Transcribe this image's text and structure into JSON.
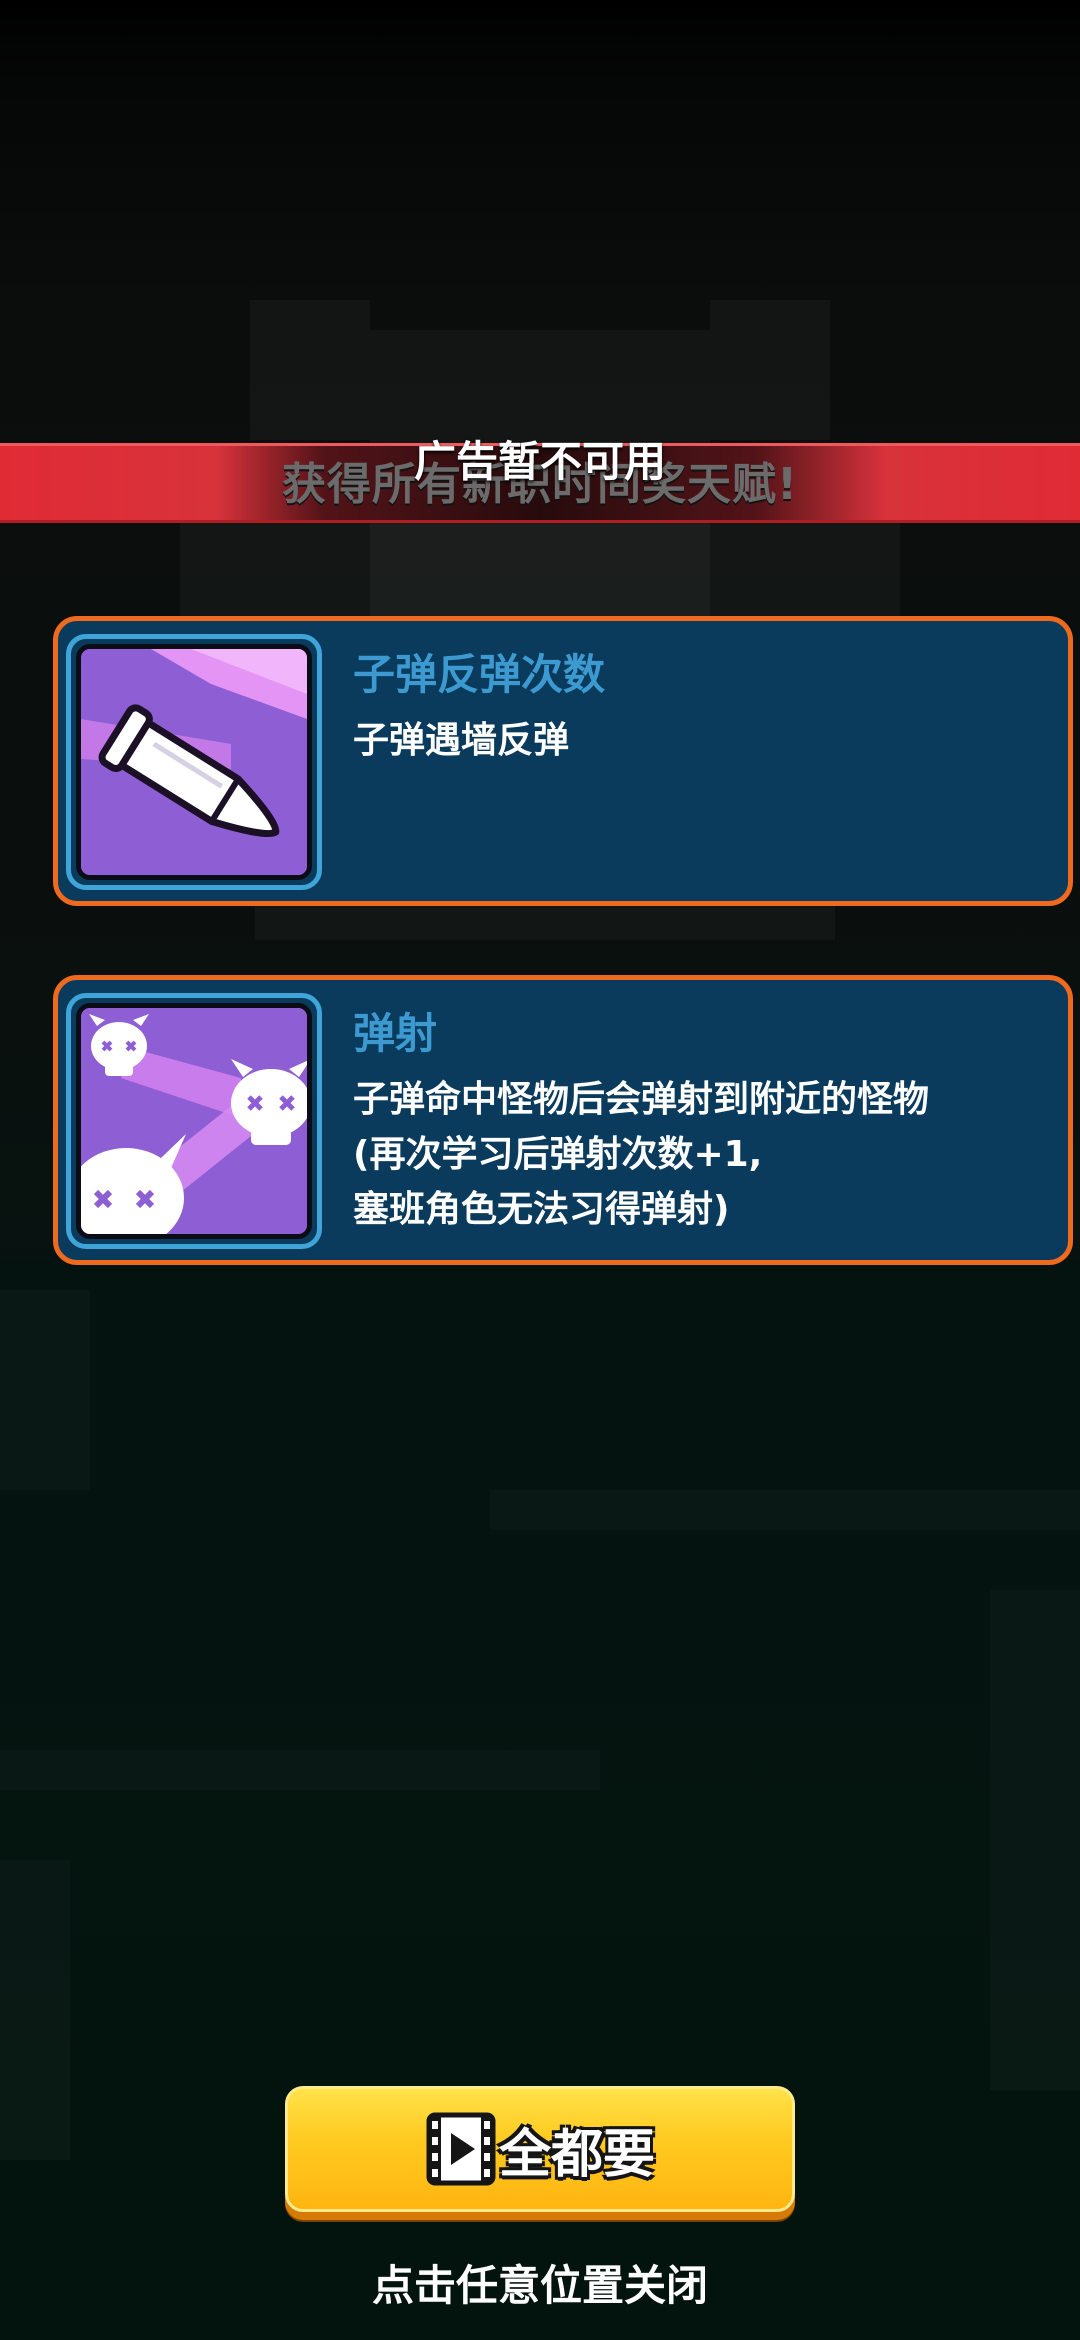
{
  "banner": {
    "title": "广告暂不可用",
    "subtitle": "获得所有新职时间奖天赋!"
  },
  "talents": [
    {
      "title": "子弹反弹次数",
      "description": "子弹遇墙反弹",
      "icon": "bullet-bounce-icon"
    },
    {
      "title": "弹射",
      "description_lines": [
        "子弹命中怪物后会弹射到附近的怪物",
        "(再次学习后弹射次数+1,",
        "塞班角色无法习得弹射)"
      ],
      "icon": "skull-ricochet-icon"
    }
  ],
  "take_all_button": {
    "label": "全都要",
    "icon": "video-ad-icon"
  },
  "close_hint": "点击任意位置关闭",
  "colors": {
    "card_bg": "#0a3a5c",
    "card_border": "#ef6a1c",
    "talent_title": "#3d9ad1",
    "icon_bg": "#9061d6",
    "button": "#ffcb22",
    "banner": "#e02b35"
  }
}
